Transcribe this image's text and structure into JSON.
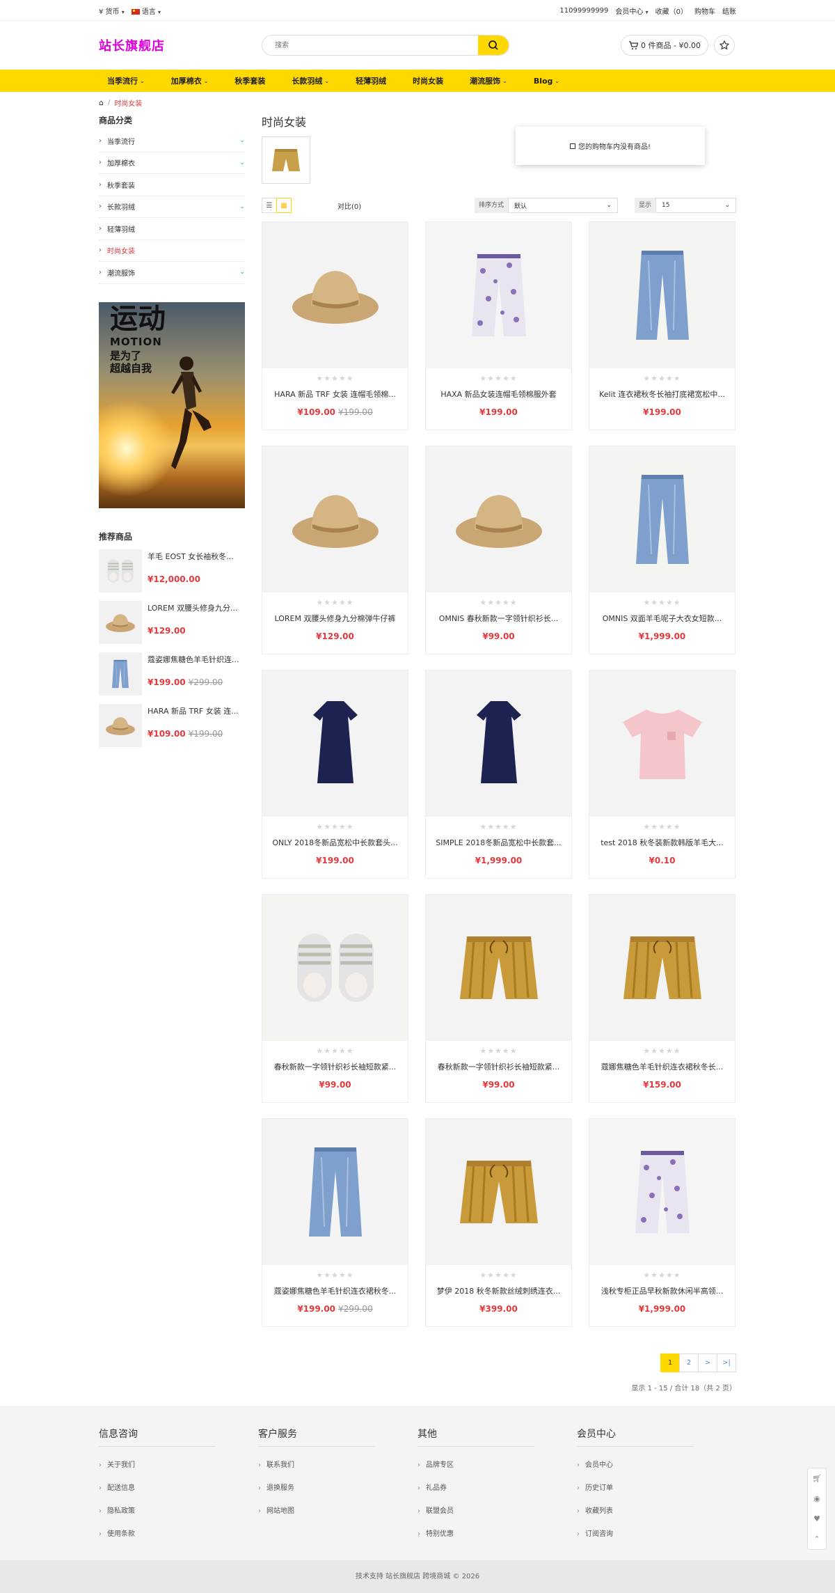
{
  "topbar": {
    "currency": "¥ 货币",
    "language": "语言",
    "phone": "11099999999",
    "member": "会员中心",
    "favorites": "收藏（0）",
    "cart": "购物车",
    "checkout": "结账"
  },
  "header": {
    "logo": "站长旗舰店",
    "search_placeholder": "搜索",
    "cart_summary": "0 件商品 - ¥0.00",
    "cart_popup": "您的购物车内没有商品!"
  },
  "nav": [
    {
      "label": "当季流行",
      "dropdown": true
    },
    {
      "label": "加厚棉衣",
      "dropdown": true
    },
    {
      "label": "秋季套装",
      "dropdown": false
    },
    {
      "label": "长款羽绒",
      "dropdown": true
    },
    {
      "label": "轻薄羽绒",
      "dropdown": false
    },
    {
      "label": "时尚女装",
      "dropdown": false
    },
    {
      "label": "潮流服饰",
      "dropdown": true
    },
    {
      "label": "Blog",
      "dropdown": true
    }
  ],
  "breadcrumb": {
    "current": "时尚女装"
  },
  "sidebar": {
    "category_title": "商品分类",
    "categories": [
      {
        "label": "当季流行",
        "expand": true,
        "active": false
      },
      {
        "label": "加厚棉衣",
        "expand": true,
        "active": false
      },
      {
        "label": "秋季套装",
        "expand": false,
        "active": false
      },
      {
        "label": "长款羽绒",
        "expand": true,
        "active": false
      },
      {
        "label": "轻薄羽绒",
        "expand": false,
        "active": false
      },
      {
        "label": "时尚女装",
        "expand": false,
        "active": true
      },
      {
        "label": "潮流服饰",
        "expand": true,
        "active": false
      }
    ],
    "banner": {
      "line1": "运动",
      "line2": "MOTION",
      "line3": "是为了",
      "line4": "超越自我"
    },
    "recommend_title": "推荐商品",
    "recommend": [
      {
        "name": "羊毛 EOST 女长袖秋冬...",
        "price": "¥12,000.00",
        "old": "",
        "icon": "slippers"
      },
      {
        "name": "LOREM 双腰头修身九分...",
        "price": "¥129.00",
        "old": "",
        "icon": "hat"
      },
      {
        "name": "蔻姿娜焦糖色羊毛针织连...",
        "price": "¥199.00",
        "old": "¥299.00",
        "icon": "jeans"
      },
      {
        "name": "HARA 新品 TRF 女装 连...",
        "price": "¥109.00",
        "old": "¥199.00",
        "icon": "hat"
      }
    ]
  },
  "main": {
    "title": "时尚女装",
    "compare": "对比(0)",
    "sort_label": "排序方式",
    "sort_value": "默认",
    "show_label": "显示",
    "show_value": "15",
    "products": [
      {
        "name": "HARA 新品 TRF 女装 连帽毛领棉...",
        "price": "¥109.00",
        "old": "¥199.00",
        "icon": "hat",
        "bg": "#f3f3f3"
      },
      {
        "name": "HAXA 新品女装连帽毛领棉服外套",
        "price": "¥199.00",
        "old": "",
        "icon": "floral",
        "bg": "#f5f5f5"
      },
      {
        "name": "Kelit 连衣裙秋冬长袖打底裙宽松中...",
        "price": "¥199.00",
        "old": "",
        "icon": "jeans",
        "bg": "#f4f4f0"
      },
      {
        "name": "LOREM 双腰头修身九分棉弹牛仔裤",
        "price": "¥129.00",
        "old": "",
        "icon": "hat",
        "bg": "#f3f3f3"
      },
      {
        "name": "OMNIS 春秋新款一字领针织衫长...",
        "price": "¥99.00",
        "old": "",
        "icon": "hat",
        "bg": "#f3f3f3"
      },
      {
        "name": "OMNIS 双面羊毛呢子大衣女短款...",
        "price": "¥1,999.00",
        "old": "",
        "icon": "jeans",
        "bg": "#f4f4f0"
      },
      {
        "name": "ONLY 2018冬新品宽松中长款套头...",
        "price": "¥199.00",
        "old": "",
        "icon": "dress",
        "bg": "#f3f3f3"
      },
      {
        "name": "SIMPLE 2018冬新品宽松中长款套...",
        "price": "¥1,999.00",
        "old": "",
        "icon": "dress",
        "bg": "#f3f3f3"
      },
      {
        "name": "test 2018 秋冬装新款韩版羊毛大...",
        "price": "¥0.10",
        "old": "",
        "icon": "tshirt",
        "bg": "#f3f3f3"
      },
      {
        "name": "春秋新款一字领针织衫长袖短款紧...",
        "price": "¥99.00",
        "old": "",
        "icon": "slippers",
        "bg": "#f5f4f0"
      },
      {
        "name": "春秋新款一字领针织衫长袖短款紧...",
        "price": "¥99.00",
        "old": "",
        "icon": "shorts",
        "bg": "#f3f3f3"
      },
      {
        "name": "蔻娜焦糖色羊毛针织连衣裙秋冬长...",
        "price": "¥159.00",
        "old": "",
        "icon": "shorts",
        "bg": "#f3f3f3"
      },
      {
        "name": "蔻姿娜焦糖色羊毛针织连衣裙秋冬...",
        "price": "¥199.00",
        "old": "¥299.00",
        "icon": "jeans",
        "bg": "#f4f4f4"
      },
      {
        "name": "梦伊 2018 秋冬新款丝绒刺绣连衣...",
        "price": "¥399.00",
        "old": "",
        "icon": "shorts",
        "bg": "#f3f3f3"
      },
      {
        "name": "浅秋专柜正品早秋新款休闲半高领...",
        "price": "¥1,999.00",
        "old": "",
        "icon": "floral",
        "bg": "#f5f5f5"
      }
    ],
    "pagination": [
      "1",
      "2",
      ">",
      ">|"
    ],
    "count_text": "显示 1 - 15 / 合计 18（共 2 页）"
  },
  "footer": {
    "columns": [
      {
        "title": "信息咨询",
        "links": [
          "关于我们",
          "配送信息",
          "隐私政策",
          "使用条款"
        ]
      },
      {
        "title": "客户服务",
        "links": [
          "联系我们",
          "退换服务",
          "网站地图"
        ]
      },
      {
        "title": "其他",
        "links": [
          "品牌专区",
          "礼品券",
          "联盟会员",
          "特别优惠"
        ]
      },
      {
        "title": "会员中心",
        "links": [
          "会员中心",
          "历史订单",
          "收藏列表",
          "订阅咨询"
        ]
      }
    ],
    "copyright": "技术支持 站长旗舰店 跨境商城 © 2026"
  },
  "colors": {
    "accent": "#ffd800",
    "price": "#e4393c",
    "logo": "#e000e0"
  }
}
